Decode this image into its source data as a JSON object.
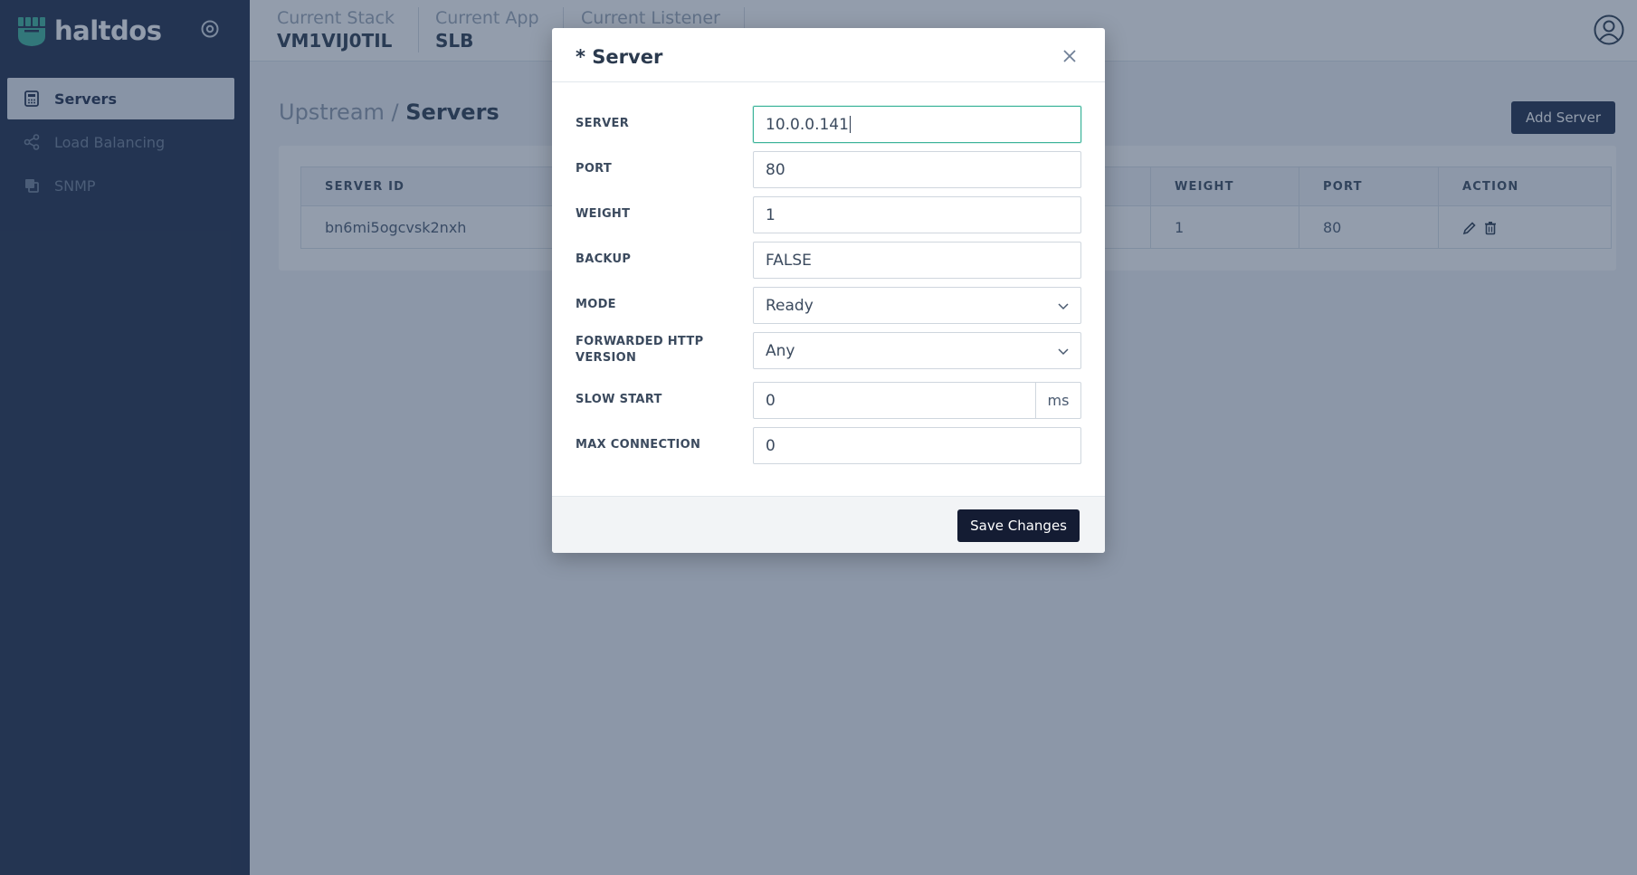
{
  "brand": {
    "name": "haltdos",
    "accent": "#3cb39a",
    "sidebar_bg": "#1f2d4a"
  },
  "sidebar": {
    "items": [
      {
        "label": "Servers",
        "icon": "calculator-icon",
        "active": true
      },
      {
        "label": "Load Balancing",
        "icon": "share-icon",
        "active": false
      },
      {
        "label": "SNMP",
        "icon": "layers-icon",
        "active": false
      }
    ]
  },
  "header": {
    "context": [
      {
        "label": "Current Stack",
        "value": "VM1VIJ0TIL"
      },
      {
        "label": "Current App",
        "value": "SLB"
      },
      {
        "label": "Current Listener",
        "value": ""
      }
    ]
  },
  "page": {
    "breadcrumb_parent": "Upstream / ",
    "breadcrumb_current": "Servers",
    "add_button": "Add Server"
  },
  "table": {
    "columns": [
      "SERVER ID",
      "WEIGHT",
      "PORT",
      "ACTION"
    ],
    "rows": [
      {
        "server_id": "bn6mi5ogcvsk2nxh",
        "weight": "1",
        "port": "80"
      }
    ]
  },
  "modal": {
    "title": "* Server",
    "fields": {
      "server": {
        "label": "SERVER",
        "value": "10.0.0.141"
      },
      "port": {
        "label": "PORT",
        "value": "80"
      },
      "weight": {
        "label": "WEIGHT",
        "value": "1"
      },
      "backup": {
        "label": "BACKUP",
        "value": "FALSE"
      },
      "mode": {
        "label": "MODE",
        "value": "Ready"
      },
      "http_version": {
        "label": "FORWARDED HTTP VERSION",
        "value": "Any"
      },
      "slow_start": {
        "label": "SLOW START",
        "value": "0",
        "unit": "ms"
      },
      "max_connection": {
        "label": "MAX CONNECTION",
        "value": "0"
      }
    },
    "save_button": "Save Changes"
  }
}
